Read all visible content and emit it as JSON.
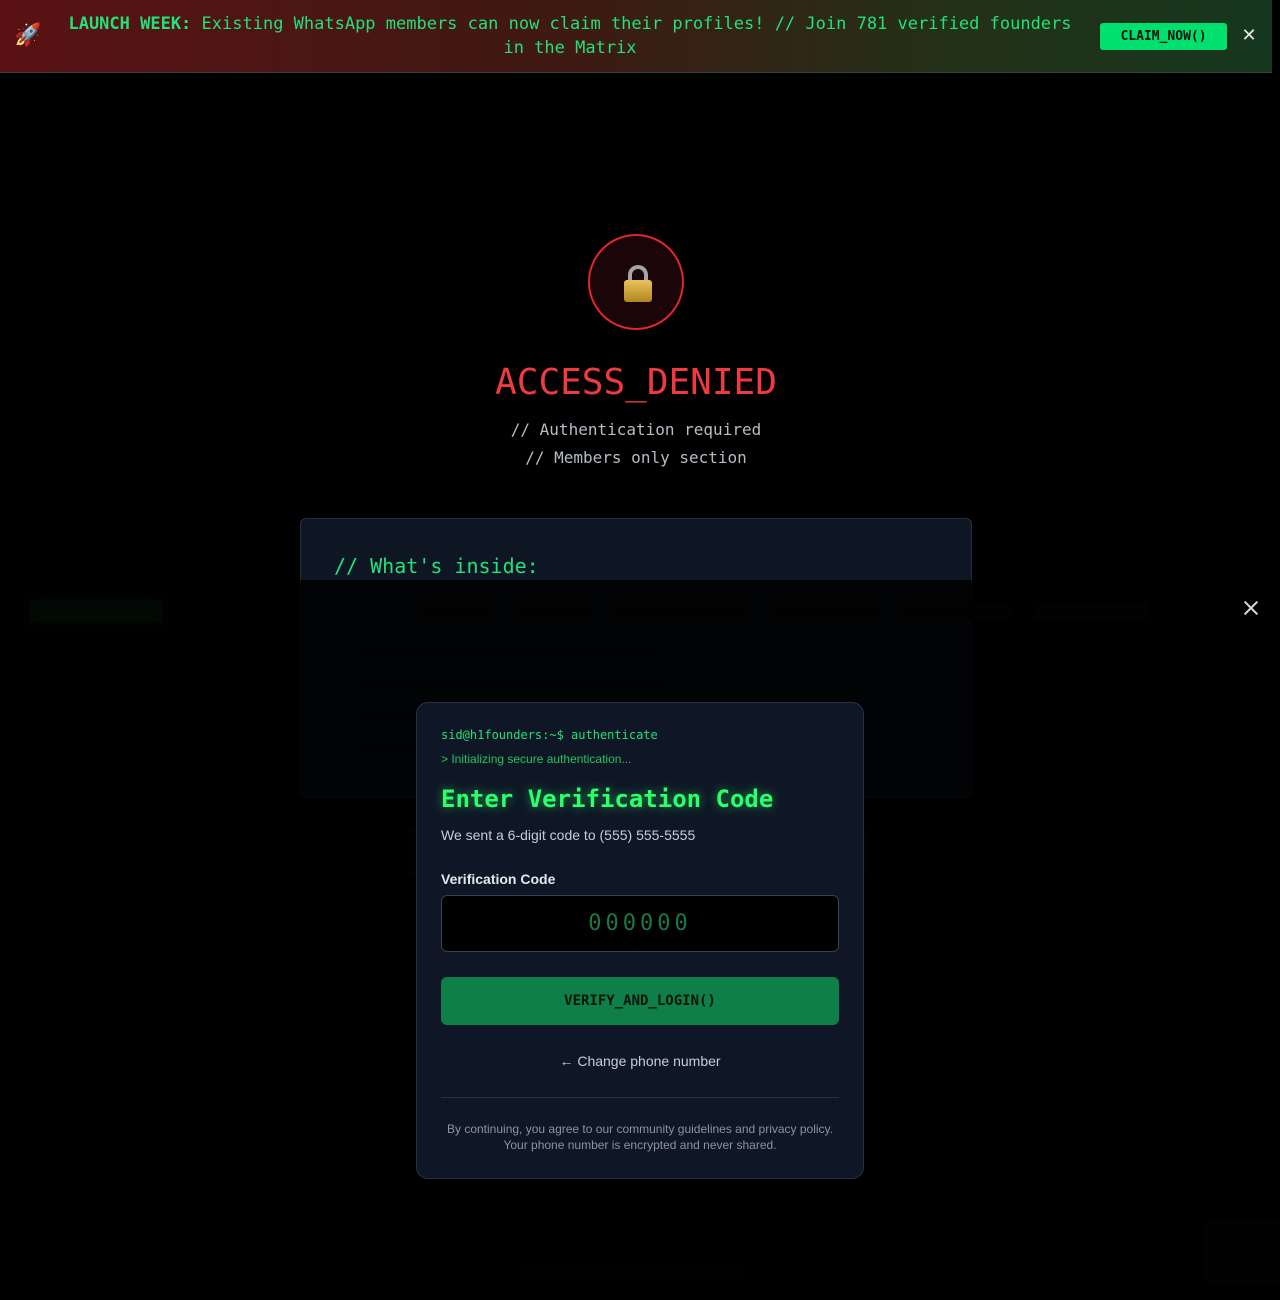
{
  "banner": {
    "icon": "rocket-icon",
    "lead": "LAUNCH WEEK:",
    "message": "Existing WhatsApp members can now claim their profiles! // Join 781 verified founders in the Matrix",
    "cta_label": "CLAIM_NOW()",
    "close_glyph": "✕"
  },
  "page": {
    "lock_icon": "lock-icon",
    "title": "ACCESS_DENIED",
    "subtitle_1": "// Authentication required",
    "subtitle_2": "// Members only section",
    "card_heading": "// What's inside:"
  },
  "modal": {
    "prompt": "sid@h1founders:~$ authenticate",
    "init_line": "> Initializing secure authentication...",
    "title": "Enter Verification Code",
    "sent_text": "We sent a 6-digit code to (555) 555-5555",
    "field_label": "Verification Code",
    "field_placeholder": "000000",
    "verify_label": "VERIFY_AND_LOGIN()",
    "change_label": "← Change phone number",
    "legal": "By continuing, you agree to our community guidelines and privacy policy. Your phone number is encrypted and never shared."
  },
  "colors": {
    "accent_green": "#22e07a",
    "denied_red": "#f03a3f",
    "verify_button": "#0f7f4a",
    "modal_bg": "#0f1726"
  }
}
